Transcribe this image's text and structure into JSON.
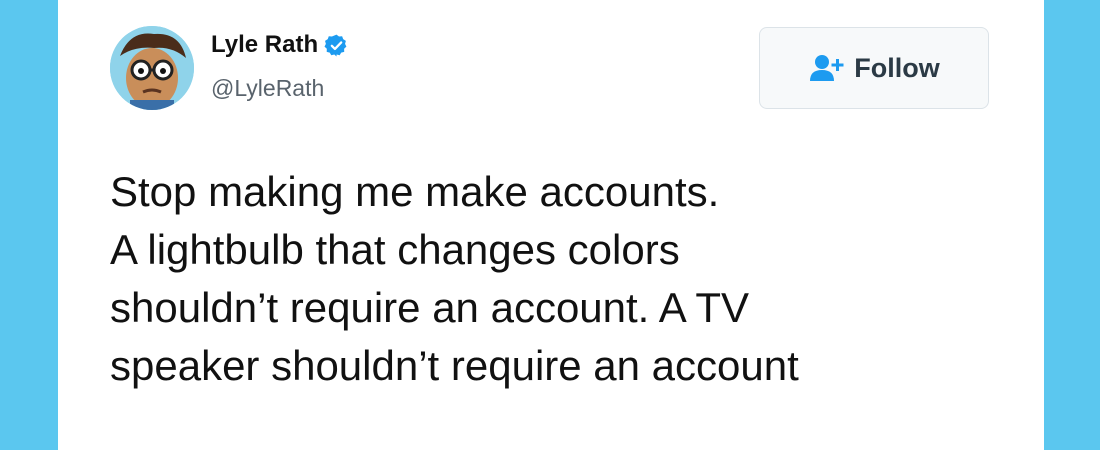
{
  "author": {
    "display_name": "Lyle Rath",
    "handle": "@LyleRath",
    "verified": true,
    "avatar_icon": "cartoon-avatar-icon"
  },
  "follow_button": {
    "label": "Follow",
    "icon": "add-user-icon"
  },
  "tweet": {
    "lines": [
      "Stop making me make accounts.",
      "A lightbulb that changes colors",
      "shouldn’t require an account. A TV",
      "speaker shouldn’t require an account"
    ]
  },
  "colors": {
    "background": "#5bc7ef",
    "card": "#ffffff",
    "verified_badge": "#1d9bf0",
    "follow_icon": "#1d9bf0"
  }
}
